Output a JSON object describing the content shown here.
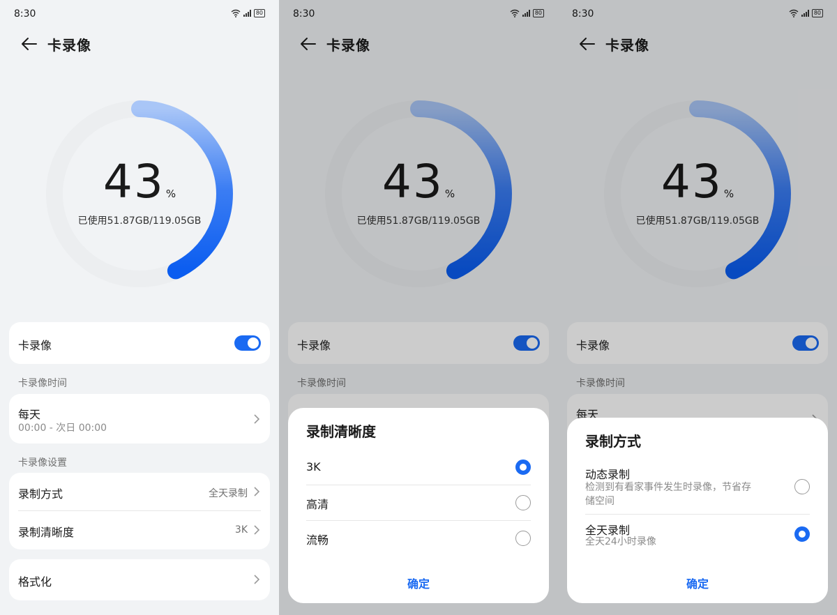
{
  "status": {
    "time": "8:30",
    "network": "4G",
    "battery": "80"
  },
  "header": {
    "title": "卡录像"
  },
  "storage": {
    "percent_number": "43",
    "percent_unit": "%",
    "used_text": "已使用51.87GB/119.05GB",
    "fraction_used": 0.43
  },
  "card_record": {
    "label": "卡录像",
    "enabled": true
  },
  "time_section": {
    "label": "卡录像时间",
    "title": "每天",
    "range": "00:00 - 次日 00:00"
  },
  "settings_section": {
    "label": "卡录像设置",
    "mode_label": "录制方式",
    "mode_value": "全天录制",
    "quality_label": "录制清晰度",
    "quality_value": "3K"
  },
  "format": {
    "label": "格式化"
  },
  "quality_sheet": {
    "title": "录制清晰度",
    "options": [
      "3K",
      "高清",
      "流畅"
    ],
    "selected": "3K",
    "confirm": "确定"
  },
  "mode_sheet": {
    "title": "录制方式",
    "options": [
      {
        "label": "动态录制",
        "desc_line1": "检测到有看家事件发生时录像，节省存",
        "desc_line2": "储空间"
      },
      {
        "label": "全天录制",
        "desc_line1": "全天24小时录像"
      }
    ],
    "selected": "全天录制",
    "confirm": "确定"
  },
  "colors": {
    "accent": "#1a6af2",
    "background": "#f1f3f5",
    "ring_track": "#eceef0"
  },
  "icons": {
    "back": "back-arrow-icon",
    "chevron": "chevron-right-icon",
    "wifi": "wifi-icon",
    "signal": "signal-icon",
    "battery": "battery-icon"
  }
}
